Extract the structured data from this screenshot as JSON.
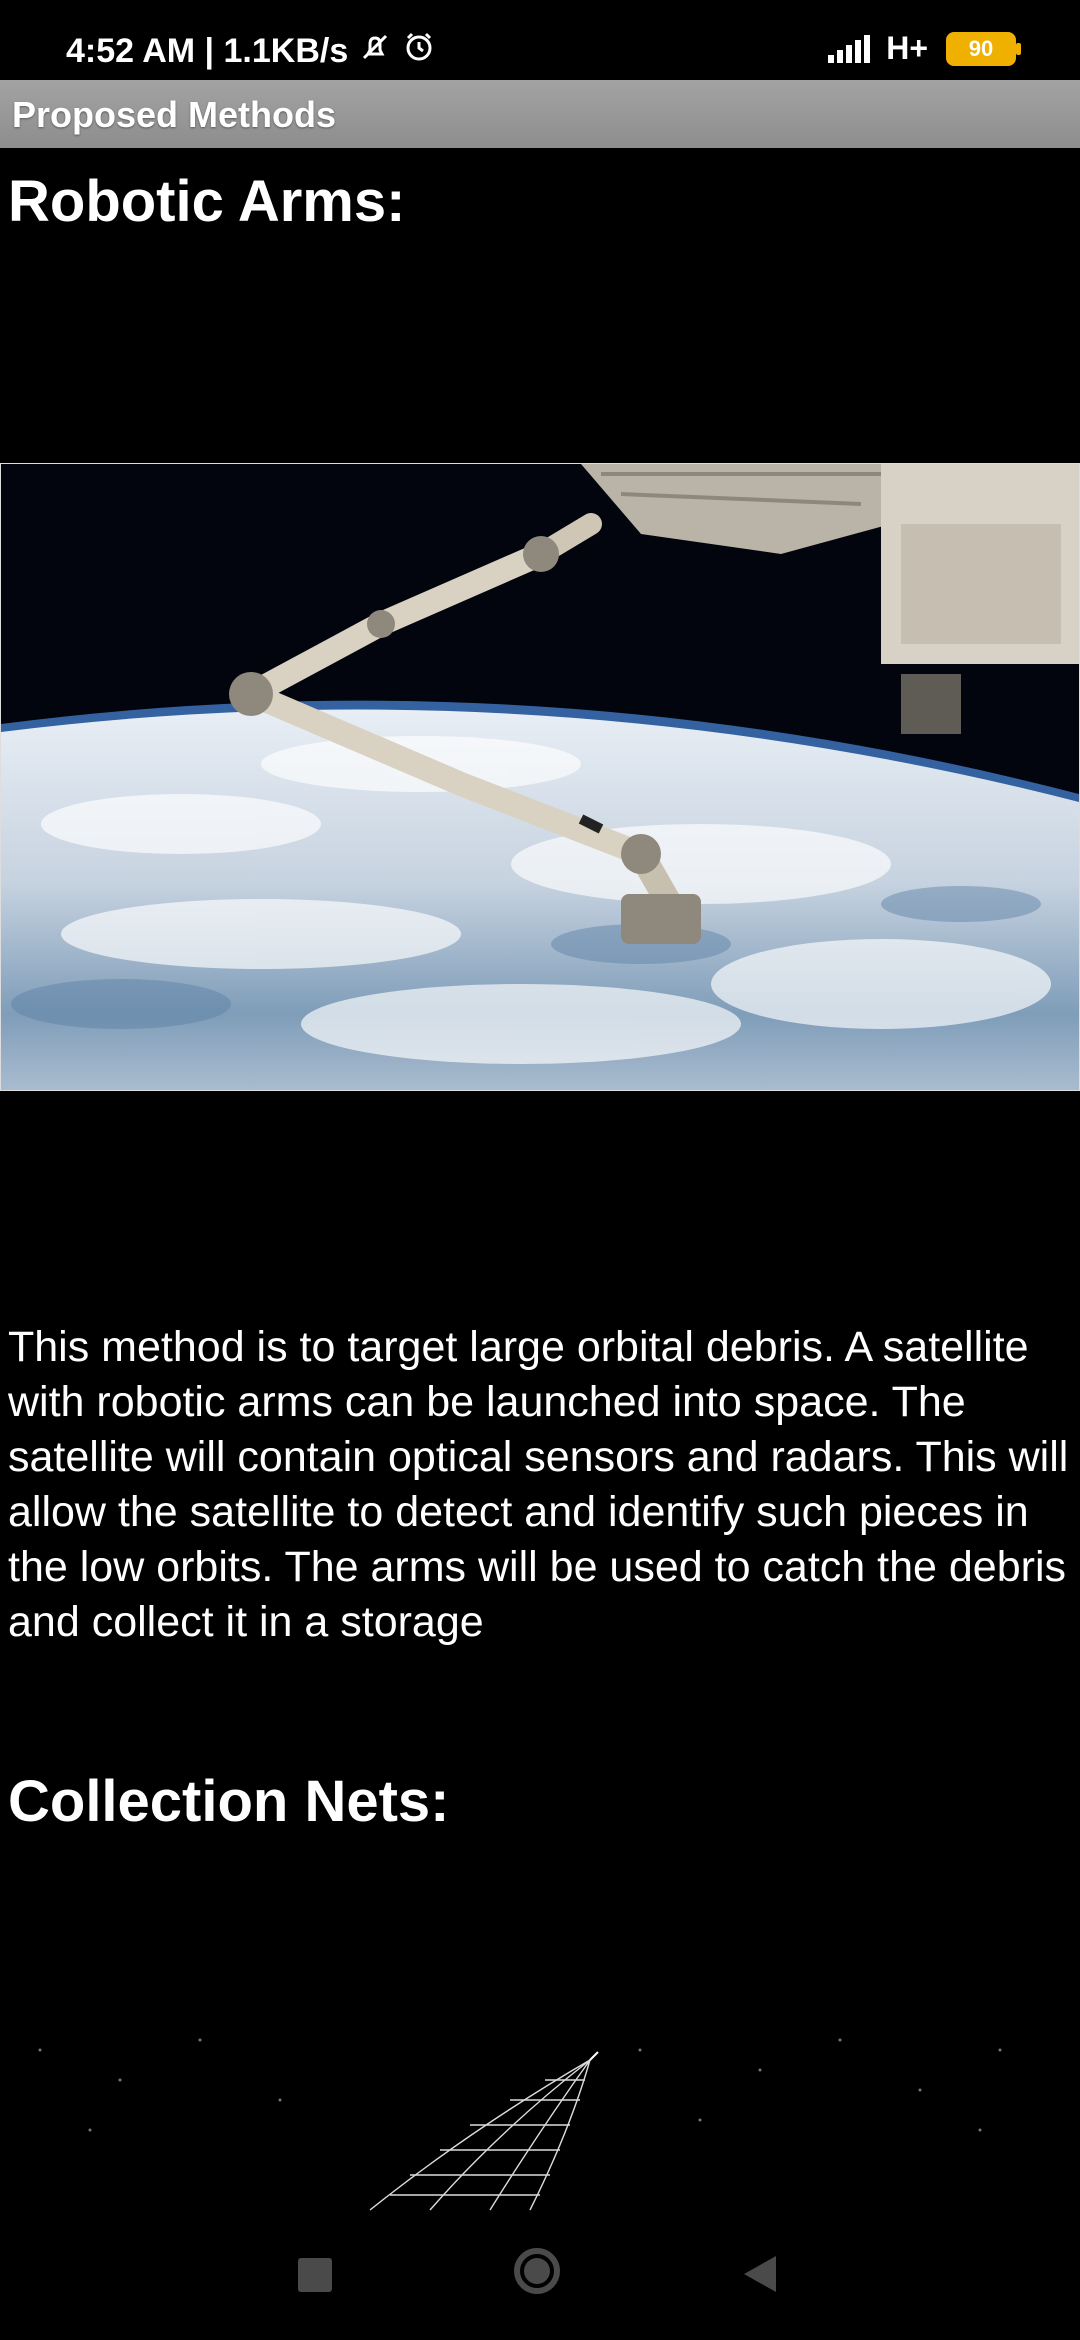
{
  "status_bar": {
    "time_speed": "4:52 AM | 1.1KB/s",
    "network": "H+",
    "battery": "90",
    "icons": [
      "mute-icon",
      "alarm-icon",
      "signal-icon",
      "battery-icon"
    ]
  },
  "header": {
    "title": "Proposed Methods"
  },
  "sections": [
    {
      "heading": "Robotic Arms:",
      "image_name": "robotic-arm-iss-image",
      "text": "This method is to target large orbital debris. A satellite with robotic arms can be launched into space. The satellite will contain optical sensors and radars. This will allow the satellite to detect and identify such pieces in the low orbits. The arms will be used to catch the debris and collect it in a storage"
    },
    {
      "heading": "Collection Nets:",
      "image_name": "collection-net-image"
    }
  ],
  "nav_bar": {
    "icons": [
      "recent-apps-icon",
      "home-icon",
      "back-icon"
    ]
  },
  "colors": {
    "background": "#000000",
    "title_bar": "#999999",
    "text": "#ffffff",
    "battery": "#f0b000"
  }
}
